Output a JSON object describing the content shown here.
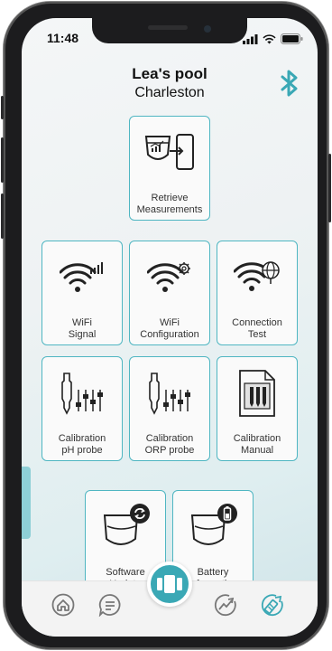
{
  "status_bar": {
    "time": "11:48",
    "icons": [
      "signal-icon",
      "wifi-icon",
      "battery-icon"
    ]
  },
  "header": {
    "title": "Lea's pool",
    "subtitle": "Charleston",
    "right_icon": "bluetooth-icon"
  },
  "tiles": {
    "retrieve": {
      "label": "Retrieve\nMeasurements",
      "icon": "retrieve-measurements-icon"
    },
    "wifi_signal": {
      "label": "WiFi\nSignal",
      "icon": "wifi-signal-icon"
    },
    "wifi_config": {
      "label": "WiFi\nConfiguration",
      "icon": "wifi-gear-icon"
    },
    "connection_test": {
      "label": "Connection\nTest",
      "icon": "wifi-globe-icon"
    },
    "cal_ph": {
      "label": "Calibration\npH probe",
      "icon": "probe-sliders-icon"
    },
    "cal_orp": {
      "label": "Calibration\nORP probe",
      "icon": "probe-sliders-icon"
    },
    "cal_manual": {
      "label": "Calibration\nManual",
      "icon": "manual-document-icon"
    },
    "software_update": {
      "label": "Software\nUpdate",
      "icon": "device-sync-icon"
    },
    "battery_info": {
      "label": "Battery\nInformation",
      "icon": "device-battery-icon"
    }
  },
  "tabbar": {
    "items": [
      "home-icon",
      "chat-icon",
      "device-center-icon",
      "trend-icon",
      "tools-icon"
    ],
    "active": "tools-icon"
  },
  "colors": {
    "accent": "#3aa8b5",
    "tile_border": "#4fb6c2",
    "text": "#111111"
  }
}
